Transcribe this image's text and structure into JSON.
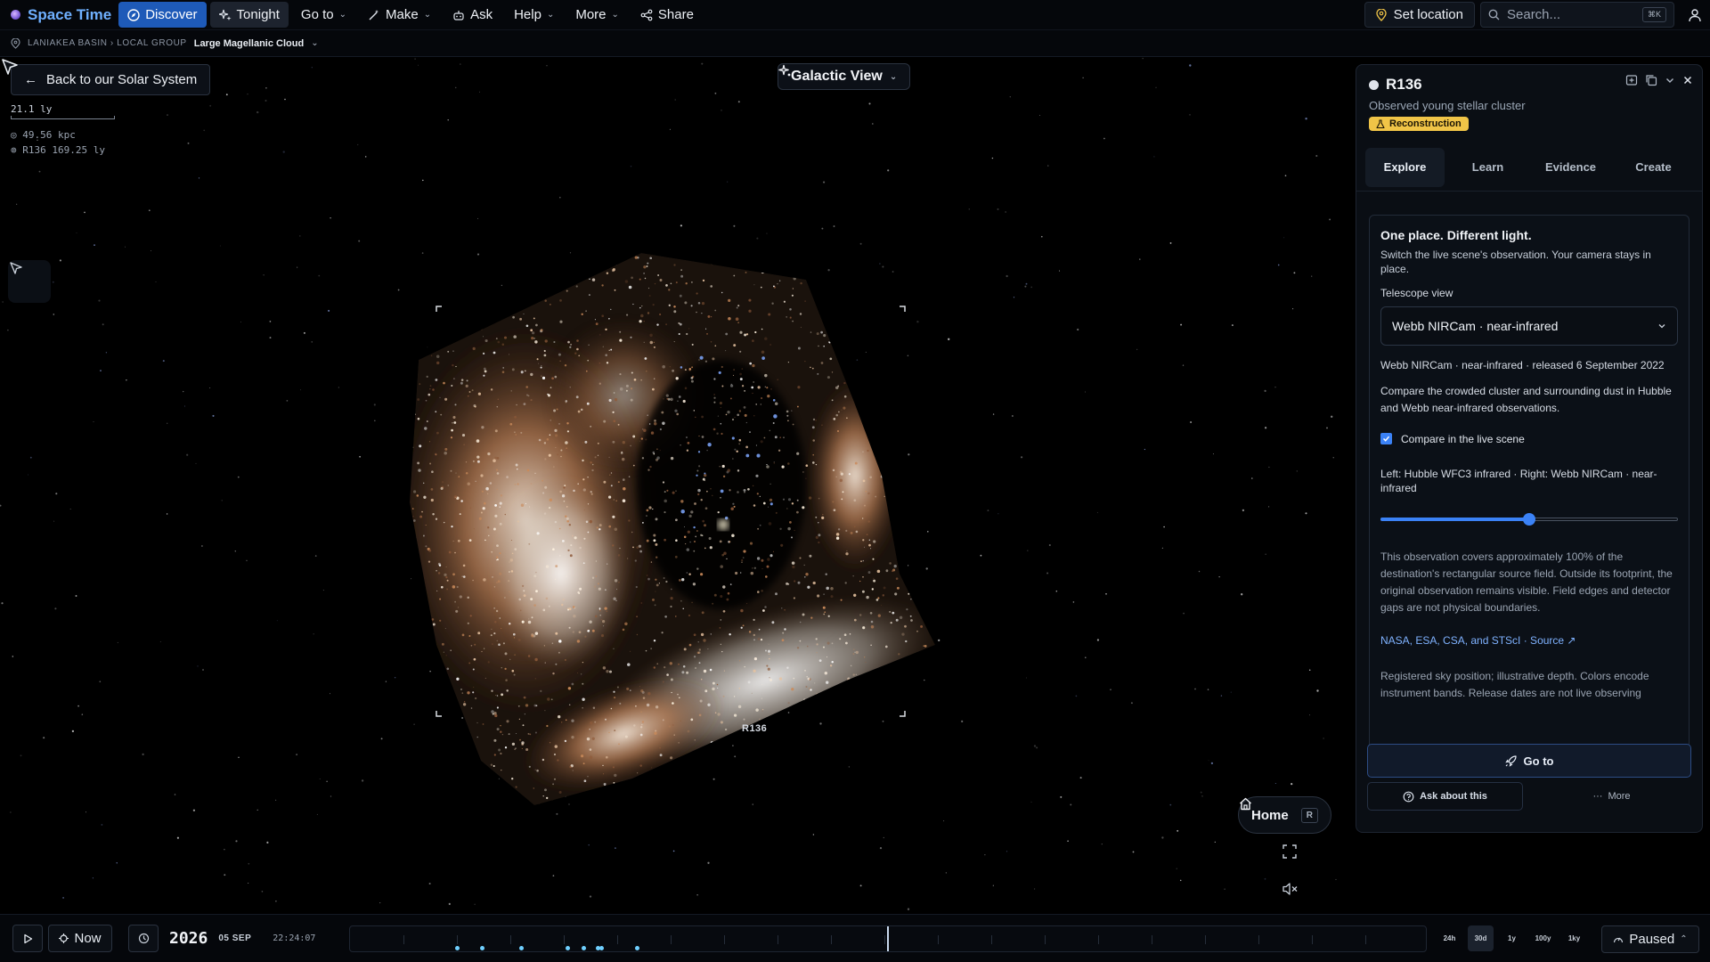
{
  "app": {
    "name": "Space Time"
  },
  "nav": {
    "discover": "Discover",
    "tonight": "Tonight",
    "goto": "Go to",
    "make": "Make",
    "ask": "Ask",
    "help": "Help",
    "more": "More",
    "share": "Share"
  },
  "top_right": {
    "set_location": "Set location",
    "search_placeholder": "Search...",
    "search_shortcut": "⌘K"
  },
  "breadcrumb": {
    "path": "LANIAKEA BASIN › LOCAL GROUP",
    "current": "Large Magellanic Cloud"
  },
  "scene": {
    "back_button": "Back to our Solar System",
    "scale_label": "21.1 ly",
    "readout_distance": "◎ 49.56 kpc",
    "readout_target": "⊚ R136 169.25 ly",
    "view_mode": "Galactic View",
    "target_label": "R136",
    "home_button": "Home",
    "home_shortcut": "R"
  },
  "panel": {
    "title": "R136",
    "subtitle": "Observed young stellar cluster",
    "badge": "Reconstruction",
    "tabs": [
      "Explore",
      "Learn",
      "Evidence",
      "Create"
    ],
    "active_tab": "Explore",
    "card": {
      "heading": "One place. Different light.",
      "description": "Switch the live scene's observation. Your camera stays in place.",
      "telescope_label": "Telescope view",
      "telescope_selected": "Webb NIRCam · near-infrared",
      "release_info": "Webb NIRCam · near-infrared · released 6 September 2022",
      "compare_text": "Compare the crowded cluster and surrounding dust in Hubble and Webb near-infrared observations.",
      "compare_checkbox": "Compare in the live scene",
      "compare_checked": true,
      "split_label": "Left: Hubble WFC3 infrared · Right: Webb NIRCam · near-infrared",
      "split_value": 0.5,
      "coverage_text": "This observation covers approximately 100% of the destination's rectangular source field. Outside its footprint, the original observation remains visible. Field edges and detector gaps are not physical boundaries.",
      "credit": "NASA, ESA, CSA, and STScI · Source ↗",
      "note": "Registered sky position; illustrative depth. Colors encode instrument bands. Release dates are not live observing"
    },
    "goto_button": "Go to",
    "ask_button": "Ask about this",
    "more_button": "More"
  },
  "bottom": {
    "now_button": "Now",
    "year": "2026",
    "date": "05 SEP",
    "time": "22:24:07",
    "zoom_levels": [
      "24h",
      "30d",
      "1y",
      "100y",
      "1ky"
    ],
    "active_zoom": "30d",
    "paused_label": "Paused"
  },
  "colors": {
    "accent": "#1e5ab8",
    "brand": "#6fb0ff",
    "badge": "#f0c447",
    "event_dot": "#6fd0ff"
  }
}
